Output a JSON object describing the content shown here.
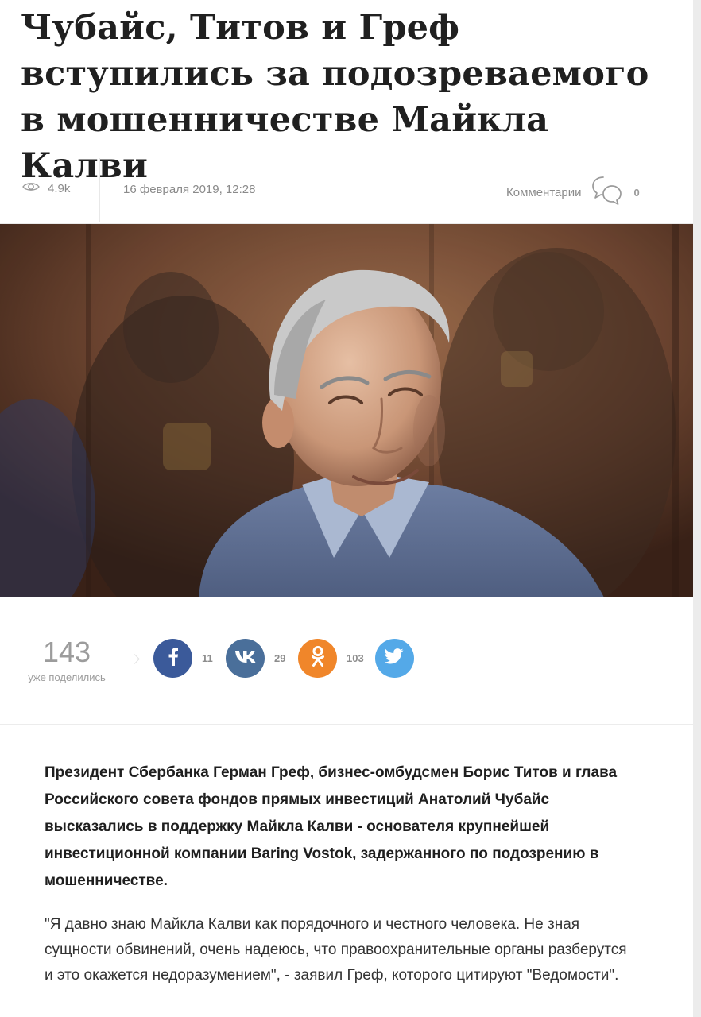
{
  "article": {
    "title": "Чубайс, Титов и Греф вступились за подозреваемого в мошенничестве Майкла Калви",
    "views": "4.9k",
    "date": "16 февраля 2019, 12:28",
    "comments_label": "Комментарии",
    "comments_count": "0",
    "lead": "Президент Сбербанка Герман Греф, бизнес-омбудсмен Борис Титов и глава Российского совета фондов прямых инвестиций Анатолий Чубайс высказались в поддержку Майкла Калви - основателя крупнейшей инвестиционной компании Baring Vostok, задержанного по подозрению в мошенничестве.",
    "quote": "\"Я давно знаю Майкла Калви как порядочного и честного человека. Не зная сущности обвинений, очень надеюсь, что правоохранительные органы разберутся и это окажется недоразумением\", - заявил Греф, которого цитируют \"Ведомости\"."
  },
  "photo": {
    "subject": "Майкл Калви"
  },
  "share": {
    "total": "143",
    "caption": "уже поделились",
    "buttons": [
      {
        "network": "facebook",
        "icon": "facebook-icon",
        "count": "11",
        "color": "#3b5a9a"
      },
      {
        "network": "vk",
        "icon": "vk-icon",
        "count": "29",
        "color": "#4a6f9a"
      },
      {
        "network": "odnoklassniki",
        "icon": "odnoklassniki-icon",
        "count": "103",
        "color": "#f0862a"
      },
      {
        "network": "twitter",
        "icon": "twitter-icon",
        "count": "",
        "color": "#54a9e8"
      }
    ]
  },
  "icons": {
    "views": "eye-icon",
    "comments": "speech-bubbles-icon"
  }
}
